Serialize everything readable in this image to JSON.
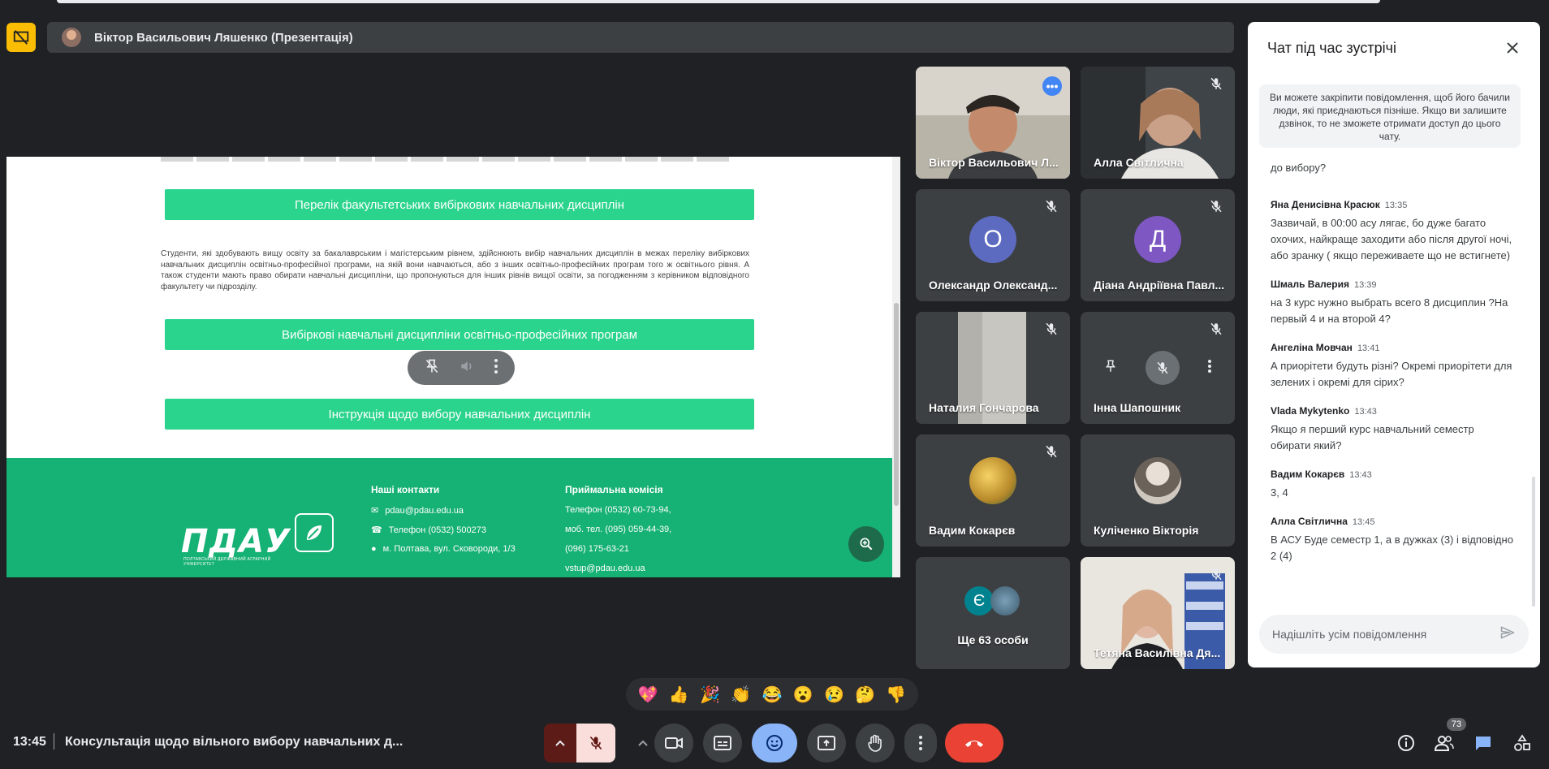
{
  "presenter_bar": {
    "name": "Віктор Васильович Ляшенко (Презентація)"
  },
  "presentation": {
    "btn1": "Перелік факультетських вибіркових навчальних дисциплін",
    "paragraph": "Студенти, які здобувають вищу освіту за бакалаврським і магістерським рівнем, здійснюють вибір навчальних дисциплін в межах переліку вибіркових навчальних дисциплін освітньо-професійної програми, на якій вони навчаються, або з інших освітньо-професійних програм того ж освітнього рівня. А також студенти мають право обирати навчальні дисципліни, що пропонуються для інших рівнів вищої освіти, за погодженням з керівником відповідного факультету чи підрозділу.",
    "btn2": "Вибіркові навчальні дисципліни освітньо-професійних програм",
    "btn3": "Інструкція щодо вибору навчальних дисциплін",
    "footer": {
      "logo": "ПДАУ",
      "logo_sub": "ПОЛТАВСЬКИЙ ДЕРЖАВНИЙ АГРАРНИЙ УНІВЕРСИТЕТ",
      "contacts_head": "Наші контакти",
      "email": "pdau@pdau.edu.ua",
      "phone": "Телефон (0532) 500273",
      "address": "м. Полтава, вул. Сковороди, 1/3",
      "admission_head": "Приймальна комісія",
      "adm_phone": "Телефон (0532) 60-73-94,",
      "adm_mob": "моб. тел. (095) 059-44-39,",
      "adm_mob2": "(096) 175-63-21",
      "adm_email": "vstup@pdau.edu.ua"
    }
  },
  "tiles": [
    {
      "name": "Віктор Васильович Л..."
    },
    {
      "name": "Алла Світлична"
    },
    {
      "name": "Олександр Олександ...",
      "letter": "О",
      "color": "#5c6bc0"
    },
    {
      "name": "Діана Андріївна Павл...",
      "letter": "Д",
      "color": "#7e57c2"
    },
    {
      "name": "Наталия Гончарова"
    },
    {
      "name": "Інна Шапошник"
    },
    {
      "name": "Вадим Кокарєв"
    },
    {
      "name": "Куліченко Вікторія"
    },
    {
      "name": "Ще 63 особи",
      "letter": "Є",
      "color": "#00838f"
    },
    {
      "name": "Тетяна Василівна Дя..."
    }
  ],
  "chat": {
    "title": "Чат під час зустрічі",
    "info": "Ви можете закріпити повідомлення, щоб його бачили люди, які приєднаються пізніше. Якщо ви залишите дзвінок, то не зможете отримати доступ до цього чату.",
    "first_line": "до вибору?",
    "messages": [
      {
        "author": "Яна Денисівна Красюк",
        "time": "13:35",
        "text": "Зазвичай, в 00:00 асу лягає, бо дуже багато охочих, найкраще заходити або після другої ночі, або зранку ( якщо переживаете що не встигнете)"
      },
      {
        "author": "Шмаль Валерия",
        "time": "13:39",
        "text": "на 3 курс нужно выбрать всего 8 дисциплин ?На первый 4 и на второй 4?"
      },
      {
        "author": "Ангеліна Мовчан",
        "time": "13:41",
        "text": "А приорітети будуть різні? Окремі приорітети для зелених і окремі для сірих?"
      },
      {
        "author": "Vlada Mykytenko",
        "time": "13:43",
        "text": "Якщо я перший курс навчальний семестр обирати який?"
      },
      {
        "author": "Вадим Кокарєв",
        "time": "13:43",
        "text": "3, 4"
      },
      {
        "author": "Алла Світлична",
        "time": "13:45",
        "text": "В АСУ Буде семестр 1, а в дужках (3) і відповідно 2 (4)"
      }
    ],
    "input_placeholder": "Надішліть усім повідомлення"
  },
  "reactions": [
    "💖",
    "👍",
    "🎉",
    "👏",
    "😂",
    "😮",
    "😢",
    "🤔",
    "👎"
  ],
  "bottom": {
    "time": "13:45",
    "title": "Консультація щодо вільного вибору навчальних д...",
    "people_count": "73"
  }
}
